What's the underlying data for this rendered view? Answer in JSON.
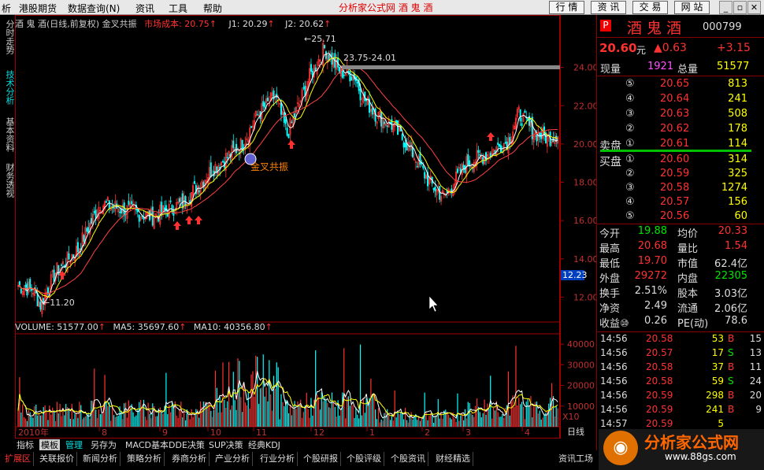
{
  "menu": [
    "析",
    "港股期货",
    "数据查询(N)",
    "资讯",
    "工具",
    "帮助"
  ],
  "center_title": "分析家公式网 酒 鬼 酒",
  "toolbar": [
    "行 情",
    "资 讯",
    "交 易",
    "网 站"
  ],
  "left_tabs": [
    "分时走势",
    "技术分析",
    "基本资料",
    "财务透视"
  ],
  "chart_header": {
    "stock": "酒 鬼 酒(日线,前复权) 金叉共振",
    "cost": "市场成本: 20.75",
    "j1": "J1: 20.29",
    "j2": "J2: 20.62"
  },
  "annotations": {
    "high": "25.71",
    "low": "11.20",
    "range": "23.75-24.01",
    "signal": "金叉共振"
  },
  "price_axis": [
    "24.00",
    "22.00",
    "20.00",
    "18.00",
    "16.00",
    "14.00",
    "12.00"
  ],
  "current_price_tag": "12.23",
  "volume_header": {
    "vol": "VOLUME: 51577.00",
    "ma5": "MA5: 35697.60",
    "ma10": "MA10: 40356.80"
  },
  "volume_axis": [
    "40000",
    "30000",
    "20000",
    "10000"
  ],
  "volume_unit": "X10",
  "time_axis": [
    "2010年",
    "8",
    "9",
    "10",
    "11",
    "12",
    "1",
    "2",
    "3",
    "4"
  ],
  "period": "日线",
  "indicator_tabs": [
    "指标",
    "模板",
    "管理",
    "另存为",
    "MACD基本",
    "DDE决策",
    "SUP决策",
    "经典KDJ"
  ],
  "bottom_tabs": [
    "扩展区",
    "关联报价",
    "新闻分析",
    "策略分析",
    "券商分析",
    "产业分析",
    "行业分析",
    "个股研报",
    "个股评级",
    "个股资讯",
    "财经精选"
  ],
  "bottom_right": "资讯工场",
  "quote": {
    "badge": "P",
    "name": "酒 鬼 酒",
    "code": "000799",
    "price": "20.60",
    "unit": "元",
    "change": "▲0.63",
    "pct": "+3.15",
    "current_vol_label": "现量",
    "current_vol": "1921",
    "total_vol_label": "总量",
    "total_vol": "51577",
    "asks": [
      {
        "lvl": "⑤",
        "price": "20.65",
        "vol": "813"
      },
      {
        "lvl": "④",
        "price": "20.64",
        "vol": "241"
      },
      {
        "lvl": "③",
        "price": "20.63",
        "vol": "508"
      },
      {
        "lvl": "②",
        "price": "20.62",
        "vol": "178"
      },
      {
        "lvl": "①",
        "price": "20.61",
        "vol": "114"
      }
    ],
    "ask_label": "卖盘",
    "bid_label": "买盘",
    "bids": [
      {
        "lvl": "①",
        "price": "20.60",
        "vol": "314"
      },
      {
        "lvl": "②",
        "price": "20.59",
        "vol": "325"
      },
      {
        "lvl": "③",
        "price": "20.58",
        "vol": "1274"
      },
      {
        "lvl": "④",
        "price": "20.57",
        "vol": "156"
      },
      {
        "lvl": "⑤",
        "price": "20.56",
        "vol": "60"
      }
    ],
    "stats": [
      [
        "今开",
        "19.88",
        "均价",
        "20.33"
      ],
      [
        "最高",
        "20.68",
        "量比",
        "1.54"
      ],
      [
        "最低",
        "19.70",
        "市值",
        "62.4亿"
      ],
      [
        "外盘",
        "29272",
        "内盘",
        "22305"
      ],
      [
        "换手",
        "2.51%",
        "股本",
        "3.03亿"
      ],
      [
        "净资",
        "2.49",
        "流通",
        "2.06亿"
      ],
      [
        "收益⑩",
        "0.26",
        "PE(动)",
        "78.6"
      ]
    ],
    "ticks": [
      [
        "14:56",
        "20.58",
        "53",
        "B",
        "15"
      ],
      [
        "14:56",
        "20.57",
        "17",
        "S",
        "13"
      ],
      [
        "14:56",
        "20.58",
        "37",
        "B",
        "11"
      ],
      [
        "14:56",
        "20.58",
        "59",
        "S",
        "24"
      ],
      [
        "14:56",
        "20.59",
        "298",
        "B",
        "20"
      ],
      [
        "14:56",
        "20.59",
        "241",
        "B",
        "9"
      ],
      [
        "14:57",
        "20.59",
        "5",
        "",
        ""
      ]
    ]
  },
  "logo": {
    "text": "分析家公式网",
    "url": "www.88gs.com"
  },
  "colors": {
    "up": "#ff3232",
    "down": "#00ffff",
    "ma1": "#ffffff",
    "ma2": "#ffff00",
    "ma3": "#ff4040"
  }
}
